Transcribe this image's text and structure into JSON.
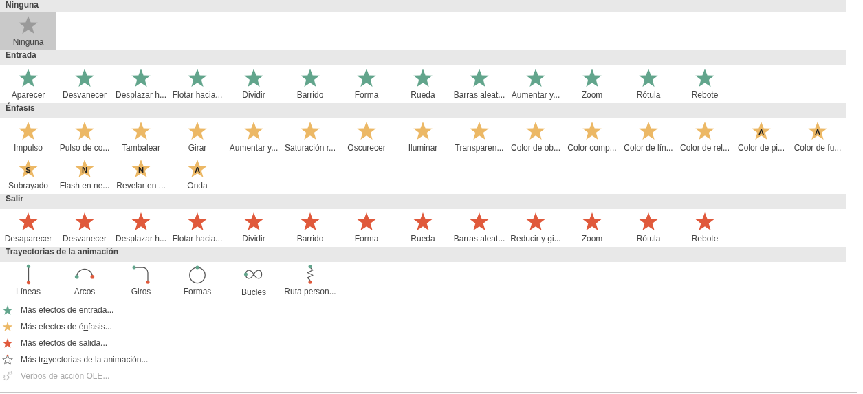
{
  "sections": [
    {
      "title": "Ninguna",
      "kind": "none",
      "items": [
        {
          "label": "Ninguna",
          "selected": true
        }
      ]
    },
    {
      "title": "Entrada",
      "kind": "entrance",
      "items": [
        {
          "label": "Aparecer",
          "selected": false
        },
        {
          "label": "Desvanecer",
          "selected": false
        },
        {
          "label": "Desplazar h...",
          "selected": false
        },
        {
          "label": "Flotar hacia...",
          "selected": false
        },
        {
          "label": "Dividir",
          "selected": false
        },
        {
          "label": "Barrido",
          "selected": false
        },
        {
          "label": "Forma",
          "selected": false
        },
        {
          "label": "Rueda",
          "selected": false
        },
        {
          "label": "Barras aleat...",
          "selected": false
        },
        {
          "label": "Aumentar y...",
          "selected": false
        },
        {
          "label": "Zoom",
          "selected": false
        },
        {
          "label": "Rótula",
          "selected": false
        },
        {
          "label": "Rebote",
          "selected": false
        }
      ]
    },
    {
      "title": "Énfasis",
      "kind": "emphasis",
      "items": [
        {
          "label": "Impulso",
          "selected": false
        },
        {
          "label": "Pulso de co...",
          "selected": false
        },
        {
          "label": "Tambalear",
          "selected": false
        },
        {
          "label": "Girar",
          "selected": false
        },
        {
          "label": "Aumentar y...",
          "selected": false
        },
        {
          "label": "Saturación r...",
          "selected": false
        },
        {
          "label": "Oscurecer",
          "selected": false
        },
        {
          "label": "Iluminar",
          "selected": false
        },
        {
          "label": "Transparen...",
          "selected": false
        },
        {
          "label": "Color de ob...",
          "selected": false
        },
        {
          "label": "Color comp...",
          "selected": false
        },
        {
          "label": "Color de lín...",
          "selected": false
        },
        {
          "label": "Color de rel...",
          "selected": false
        },
        {
          "label": "Color de pi...",
          "selected": false,
          "glyph": "A"
        },
        {
          "label": "Color de fu...",
          "selected": false,
          "glyph": "A"
        },
        {
          "label": "Subrayado",
          "selected": false,
          "glyph": "S"
        },
        {
          "label": "Flash en ne...",
          "selected": false,
          "glyph": "N"
        },
        {
          "label": "Revelar en ...",
          "selected": false,
          "glyph": "N"
        },
        {
          "label": "Onda",
          "selected": false,
          "glyph": "A"
        }
      ]
    },
    {
      "title": "Salir",
      "kind": "exit",
      "items": [
        {
          "label": "Desaparecer",
          "selected": false
        },
        {
          "label": "Desvanecer",
          "selected": false
        },
        {
          "label": "Desplazar h...",
          "selected": false
        },
        {
          "label": "Flotar hacia...",
          "selected": false
        },
        {
          "label": "Dividir",
          "selected": false
        },
        {
          "label": "Barrido",
          "selected": false
        },
        {
          "label": "Forma",
          "selected": false
        },
        {
          "label": "Rueda",
          "selected": false
        },
        {
          "label": "Barras aleat...",
          "selected": false
        },
        {
          "label": "Reducir y gi...",
          "selected": false
        },
        {
          "label": "Zoom",
          "selected": false
        },
        {
          "label": "Rótula",
          "selected": false
        },
        {
          "label": "Rebote",
          "selected": false
        }
      ]
    },
    {
      "title": "Trayectorias de la animación",
      "kind": "path",
      "items": [
        {
          "label": "Líneas",
          "selected": false,
          "kind": "line"
        },
        {
          "label": "Arcos",
          "selected": false,
          "kind": "arc"
        },
        {
          "label": "Giros",
          "selected": false,
          "kind": "turn"
        },
        {
          "label": "Formas",
          "selected": false,
          "kind": "circle"
        },
        {
          "label": "Bucles",
          "selected": false,
          "kind": "loop"
        },
        {
          "label": "Ruta person...",
          "selected": false,
          "kind": "custom"
        }
      ]
    }
  ],
  "menu": [
    {
      "kind": "entrance",
      "before": "Más ",
      "key": "e",
      "after": "fectos de entrada...",
      "disabled": false
    },
    {
      "kind": "emphasis",
      "before": "Más efectos de é",
      "key": "n",
      "after": "fasis...",
      "disabled": false
    },
    {
      "kind": "exit",
      "before": "Más efectos de ",
      "key": "s",
      "after": "alida...",
      "disabled": false
    },
    {
      "kind": "path",
      "before": "Más tr",
      "key": "a",
      "after": "yectorias de la animación...",
      "disabled": false
    },
    {
      "kind": "ole",
      "before": "Verbos de acción ",
      "key": "O",
      "after": "LE...",
      "disabled": true
    }
  ]
}
